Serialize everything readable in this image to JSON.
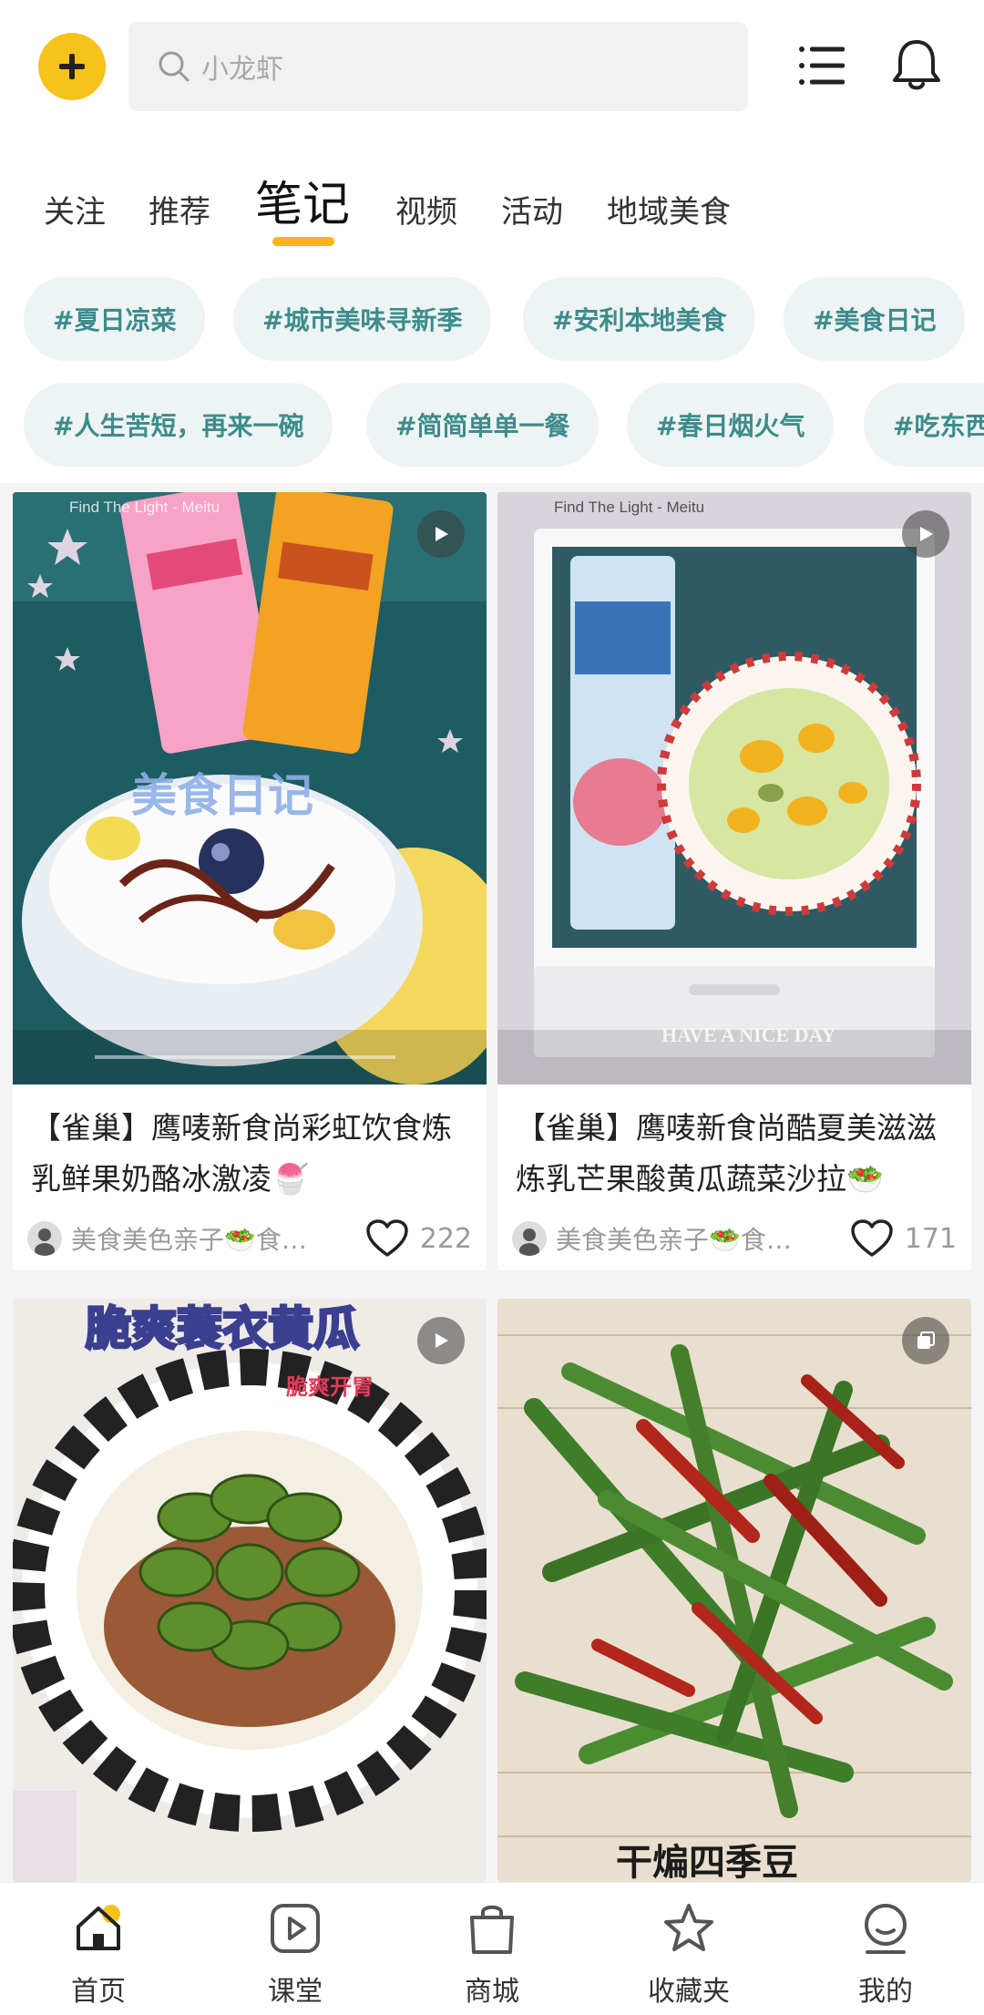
{
  "header": {
    "search_placeholder": "小龙虾",
    "icons": [
      "plus-icon",
      "search-icon",
      "menu-list-icon",
      "bell-icon"
    ],
    "accent_color": "#f8c21d"
  },
  "tabs": [
    {
      "label": "关注",
      "active": false
    },
    {
      "label": "推荐",
      "active": false
    },
    {
      "label": "笔记",
      "active": true
    },
    {
      "label": "视频",
      "active": false
    },
    {
      "label": "活动",
      "active": false
    },
    {
      "label": "地域美食",
      "active": false
    }
  ],
  "topics_row1": [
    "#夏日凉菜",
    "#城市美味寻新季",
    "#安利本地美食",
    "#美食日记"
  ],
  "topics_row2": [
    "#人生苦短，再来一碗",
    "#简简单单一餐",
    "#春日烟火气",
    "#吃东西"
  ],
  "feed": [
    {
      "image_text": "Find The Light - Meitu",
      "overlay_text": "美食日记",
      "title": "【雀巢】鹰唛新食尚彩虹饮食炼乳鲜果奶酪冰激凌🍧",
      "author": "美食美色亲子🥗食…",
      "likes": "222",
      "type": "video"
    },
    {
      "image_text": "Find The Light - Meitu",
      "overlay_text": "HAVE A NICE DAY",
      "title": "【雀巢】鹰唛新食尚酷夏美滋滋炼乳芒果酸黄瓜蔬菜沙拉🥗",
      "author": "美食美色亲子🥗食…",
      "likes": "171",
      "type": "video"
    },
    {
      "overlay_text": "脆爽蓑衣黄瓜",
      "sub_overlay": "脆爽开胃",
      "type": "video"
    },
    {
      "overlay_text": "干煸四季豆",
      "type": "gallery"
    }
  ],
  "bottom_nav": [
    {
      "label": "首页",
      "icon": "home-icon",
      "active": true
    },
    {
      "label": "课堂",
      "icon": "play-square-icon",
      "active": false
    },
    {
      "label": "商城",
      "icon": "shopping-bag-icon",
      "active": false
    },
    {
      "label": "收藏夹",
      "icon": "star-icon",
      "active": false
    },
    {
      "label": "我的",
      "icon": "profile-icon",
      "active": false
    }
  ]
}
